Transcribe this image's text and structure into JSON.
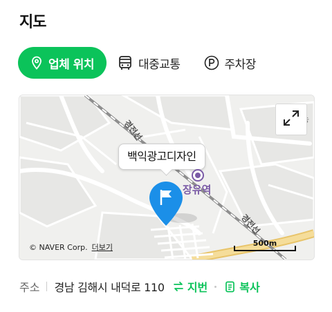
{
  "section": {
    "title": "지도"
  },
  "tabs": [
    {
      "label": "업체 위치",
      "icon": "location-pin-icon",
      "active": true
    },
    {
      "label": "대중교통",
      "icon": "bus-icon",
      "active": false
    },
    {
      "label": "주차장",
      "icon": "parking-icon",
      "active": false
    }
  ],
  "map": {
    "place_name": "백익광고디자인",
    "station_label": "장유역",
    "road_labels": [
      "경전선",
      "경전선"
    ],
    "partial_label": "농",
    "attribution": "© NAVER Corp.",
    "more_link": "더보기",
    "scale_label": "500m",
    "colors": {
      "pin": "#1b8fe8",
      "rail": "#9a9a9a",
      "highway": "#f1d58a"
    }
  },
  "address": {
    "label": "주소",
    "value": "경남 김해시 내덕로 110",
    "lot_button": "지번",
    "copy_button": "복사"
  },
  "accent_color": "#0bc35a"
}
